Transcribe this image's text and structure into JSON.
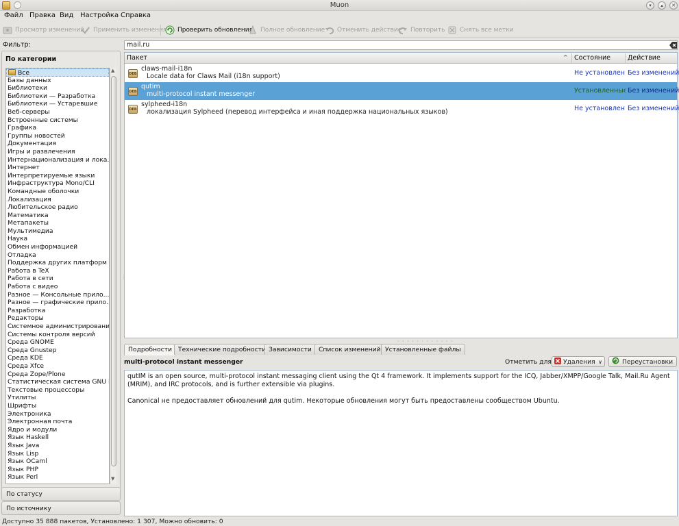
{
  "window": {
    "title": "Muon"
  },
  "menu": [
    "Файл",
    "Правка",
    "Вид",
    "Настройка",
    "Справка"
  ],
  "toolbar": {
    "review": "Просмотр изменений",
    "apply": "Применить изменения",
    "check_updates": "Проверить обновления",
    "full_upgrade": "Полное обновление",
    "undo": "Отменить действие",
    "redo": "Повторить",
    "unmark_all": "Снять все метки"
  },
  "filter": {
    "label": "Фильтр:",
    "by_category": "По категории",
    "categories": [
      "Все",
      "Базы данных",
      "Библиотеки",
      "Библиотеки — Разработка",
      "Библиотеки — Устаревшие",
      "Веб-серверы",
      "Встроенные системы",
      "Графика",
      "Группы новостей",
      "Документация",
      "Игры и развлечения",
      "Интернационализация и лока...",
      "Интернет",
      "Интерпретируемые языки",
      "Инфраструктура Mono/CLI",
      "Командные оболочки",
      "Локализация",
      "Любительское радио",
      "Математика",
      "Метапакеты",
      "Мультимедиа",
      "Наука",
      "Обмен информацией",
      "Отладка",
      "Поддержка других платформ",
      "Работа в TeX",
      "Работа в сети",
      "Работа с видео",
      "Разное — Консольные прило...",
      "Разное — графические прило...",
      "Разработка",
      "Редакторы",
      "Системное администрирование",
      "Системы контроля версий",
      "Среда GNOME",
      "Среда Gnustep",
      "Среда KDE",
      "Среда Xfce",
      "Среда Zope/Plone",
      "Статистическая система GNU R",
      "Текстовые процессоры",
      "Утилиты",
      "Шрифты",
      "Электроника",
      "Электронная почта",
      "Ядро и модули",
      "Язык Haskell",
      "Язык Java",
      "Язык Lisp",
      "Язык OCaml",
      "Язык PHP",
      "Язык Perl"
    ],
    "by_status": "По статусу",
    "by_source": "По источнику"
  },
  "search": {
    "value": "mail.ru"
  },
  "table": {
    "headers": {
      "package": "Пакет",
      "status": "Состояние",
      "action": "Действие"
    },
    "rows": [
      {
        "name": "claws-mail-i18n",
        "desc": "Locale data for Claws Mail (i18n support)",
        "status": "Не установлен...",
        "action": "Без изменений",
        "selected": false
      },
      {
        "name": "qutim",
        "desc": "multi-protocol instant messenger",
        "status": "Установленные",
        "action": "Без изменений",
        "selected": true
      },
      {
        "name": "sylpheed-i18n",
        "desc": "локализация Sylpheed (перевод интерфейса и иная поддержка национальных языков)",
        "status": "Не установлен...",
        "action": "Без изменений",
        "selected": false
      }
    ],
    "icon_text": "DEB"
  },
  "tabs": [
    "Подробности",
    "Технические подробности",
    "Зависимости",
    "Список изменений",
    "Установленные файлы"
  ],
  "details": {
    "title": "multi-protocol instant messenger",
    "mark_label": "Отметить для:",
    "remove_option": "Удаления",
    "reinstall": "Переустановки",
    "para1": "qutIM is an open source, multi-protocol instant messaging client using the Qt 4 framework. It implements support for the ICQ, Jabber/XMPP/Google Talk, Mail.Ru Agent (MRIM), and IRC protocols, and is further extensible via plugins.",
    "para2": "Canonical не предоставляет обновлений для qutim. Некоторые обновления могут быть предоставлены сообществом Ubuntu."
  },
  "status_bar": "Доступно 35 888 пакетов, Установлено: 1 307, Можно обновить: 0",
  "colors": {
    "selection": "#5aa1d6",
    "not_installed": "#1a35b8",
    "installed": "#2e8b3a",
    "action": "#1a35b8"
  }
}
